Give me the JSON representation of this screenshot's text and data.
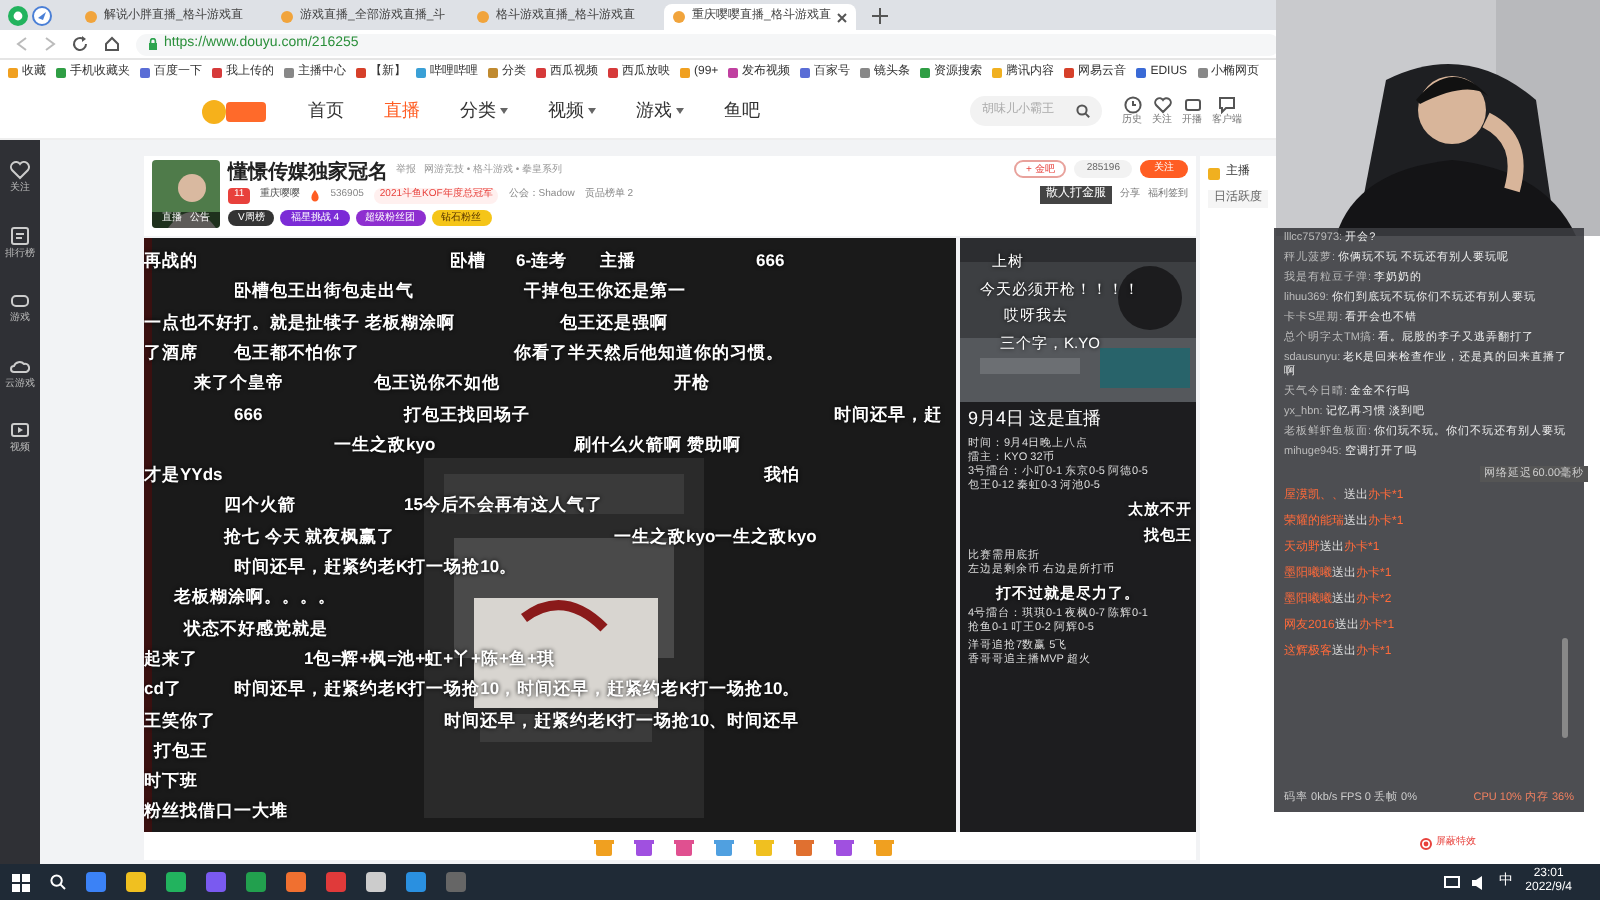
{
  "browser": {
    "tabs": [
      {
        "label": "解说小胖直播_格斗游戏直",
        "selected": false
      },
      {
        "label": "游戏直播_全部游戏直播_斗",
        "selected": false
      },
      {
        "label": "格斗游戏直播_格斗游戏直",
        "selected": false
      },
      {
        "label": "重庆嘤嘤直播_格斗游戏直",
        "selected": true
      }
    ],
    "url": "https://www.douyu.com/216255",
    "bookmarks": [
      "收藏",
      "手机收藏夹",
      "百度一下",
      "我上传的",
      "主播中心",
      "【新】",
      "哔哩哔哩",
      "分类",
      "西瓜视频",
      "西瓜放映",
      "(99+",
      "发布视频",
      "百家号",
      "镜头条",
      "资源搜索",
      "腾讯内容",
      "网易云音",
      "EDIUS",
      "小椭网页"
    ]
  },
  "site": {
    "nav": [
      {
        "label": "首页",
        "selected": false,
        "dropdown": false
      },
      {
        "label": "直播",
        "selected": true,
        "dropdown": false
      },
      {
        "label": "分类",
        "selected": false,
        "dropdown": true
      },
      {
        "label": "视频",
        "selected": false,
        "dropdown": true
      },
      {
        "label": "游戏",
        "selected": false,
        "dropdown": true
      },
      {
        "label": "鱼吧",
        "selected": false,
        "dropdown": false
      }
    ],
    "search": {
      "placeholder": "胡味儿小霸王"
    },
    "header_icons": [
      {
        "kind": "history",
        "label": "历史"
      },
      {
        "kind": "heart",
        "label": "关注"
      },
      {
        "kind": "broadcast",
        "label": "开播"
      },
      {
        "kind": "client",
        "label": "客户端"
      }
    ]
  },
  "sidebar": [
    {
      "kind": "heart",
      "label": "关注"
    },
    {
      "kind": "rank",
      "label": "排行榜"
    },
    {
      "kind": "game",
      "label": "游戏"
    },
    {
      "kind": "cloud",
      "label": "云游戏"
    },
    {
      "kind": "video",
      "label": "视频"
    }
  ],
  "room": {
    "avatar_tabs": [
      "直播",
      "公告"
    ],
    "title": "懂憬传媒独家冠名",
    "report": "举报",
    "breadcrumb": "网游竞技 • 格斗游戏 • 拳皇系列",
    "level": "11",
    "streamer": "重庆嘤嘤",
    "hot": "536905",
    "honor": "2021斗鱼KOF年度总冠军",
    "guild": "公会：Shadow",
    "gift_rank": "贡品榜单 2",
    "badges": [
      {
        "label": "V周榜",
        "color": "#333333"
      },
      {
        "label": "福星挑战 4",
        "color": "#7b2bd6"
      },
      {
        "label": "超级粉丝团",
        "color": "#8e2fd0"
      },
      {
        "label": "钻石粉丝",
        "color": "#f5c518"
      }
    ],
    "fan_group": "+ 金吧",
    "followers": "285196",
    "follow": "关注",
    "server": "散人打金服",
    "share": "分享",
    "sign_in": "福利签到"
  },
  "danmaku": [
    [
      "再战的",
      "卧槽",
      "6-连考",
      "主播",
      "666"
    ],
    [
      "卧槽包王出街包走出气",
      "干掉包王你还是第一"
    ],
    [
      "一点也不好打。就是扯犊子 老板糊涂啊",
      "包王还是强啊"
    ],
    [
      "了酒席",
      "包王都不怕你了",
      "你看了半天然后他知道你的习惯。"
    ],
    [
      "来了个皇帝",
      "包王说你不如他",
      "开枪"
    ],
    [
      "666",
      "打包王找回场子",
      "时间还早，赶"
    ],
    [
      "一生之敌kyo",
      "刷什么火箭啊 赞助啊"
    ],
    [
      "才是YYds",
      "我怕"
    ],
    [
      "四个火箭",
      "15今后不会再有这人气了"
    ],
    [
      "抢七 今天 就夜枫赢了",
      "一生之敌kyo一生之敌kyo"
    ],
    [
      "时间还早，赶紧约老K打一场抢10。"
    ],
    [
      "老板糊涂啊。。。。"
    ],
    [
      "状态不好感觉就是"
    ],
    [
      "起来了",
      "1包=辉+枫=池+虹+丫+陈+鱼+琪"
    ],
    [
      "cd了",
      "时间还早，赶紧约老K打一场抢10，时间还早，赶紧约老K打一场抢10。"
    ],
    [
      "王笑你了",
      "时间还早，赶紧约老K打一场抢10、时间还早"
    ],
    [
      "打包王"
    ],
    [
      "时下班"
    ],
    [
      "粉丝找借口一大堆"
    ]
  ],
  "side_player": {
    "danmaku": [
      "上树",
      "今天必须开枪！！！！",
      "哎呀我去",
      "三个字，K.YO"
    ],
    "headline": "9月4日 这是直播",
    "info_groups": [
      [
        "时间：9月4日晚上八点",
        "擂主：KYO 32币",
        "3号擂台：小叮0-1 东京0-5 阿德0-5",
        "包王0-12 秦虹0-3 河池0-5"
      ],
      [
        "比赛需用底折",
        "左边是剩余币 右边是所打币"
      ],
      [
        "4号擂台：琪琪0-1 夜枫0-7 陈辉0-1",
        "抢鱼0-1 叮王0-2 阿辉0-5"
      ],
      [
        "洋哥追抢7数赢 5飞",
        "香哥哥追主播MVP 超火"
      ]
    ],
    "overlay": [
      "太放不开",
      "找包王",
      "打不过就是尽力了。"
    ]
  },
  "right_column": {
    "tab": "主播",
    "activity": "日活跃度"
  },
  "chat": {
    "messages": [
      {
        "user": "lllcc757973:",
        "text": "开会?"
      },
      {
        "user": "秤儿菠萝:",
        "text": "你俩玩不玩 不玩还有别人要玩呢"
      },
      {
        "user": "我是有粒豆子弹:",
        "text": "李奶奶的"
      },
      {
        "user": "lihuu369:",
        "text": "你们到底玩不玩你们不玩还有别人要玩"
      },
      {
        "user": "卡卡S星期:",
        "text": "看开会也不错"
      },
      {
        "user": "总个明字太TM搞:",
        "text": "看。屁股的李子又逃弄翻打了"
      },
      {
        "user": "sdausunyu:",
        "text": "老K是回来检查作业，还是真的回来直播了啊"
      },
      {
        "user": "天气今日晴:",
        "text": "金金不行吗"
      },
      {
        "user": "yx_hbn:",
        "text": "记忆再习惯 淡到吧"
      },
      {
        "user": "老板鲜虾鱼板面:",
        "text": "你们玩不玩。你们不玩还有别人要玩"
      },
      {
        "user": "mihuge945:",
        "text": "空调打开了吗"
      }
    ],
    "latency": "网络延迟60.00毫秒",
    "gifts": [
      {
        "user": "屋漠凯、、",
        "action": "送出",
        "gift": "办卡*1"
      },
      {
        "user": "荣耀的能瑞",
        "action": "送出",
        "gift": "办卡*1"
      },
      {
        "user": "天动野",
        "action": "送出",
        "gift": "办卡*1"
      },
      {
        "user": "墨阳曦曦",
        "action": "送出",
        "gift": "办卡*1"
      },
      {
        "user": "墨阳曦曦",
        "action": "送出",
        "gift": "办卡*2"
      },
      {
        "user": "网友2016",
        "action": "送出",
        "gift": "办卡*1"
      },
      {
        "user": "这辉极客",
        "action": "送出",
        "gift": "办卡*1"
      }
    ],
    "stats_left": "码率 0kb/s FPS 0 丢帧 0%",
    "stats_right": "CPU 10% 内存 36%"
  },
  "effects_toggle": "屏蔽特效",
  "taskbar": {
    "ime": "中",
    "time": "23:01",
    "date": "2022/9/4"
  }
}
